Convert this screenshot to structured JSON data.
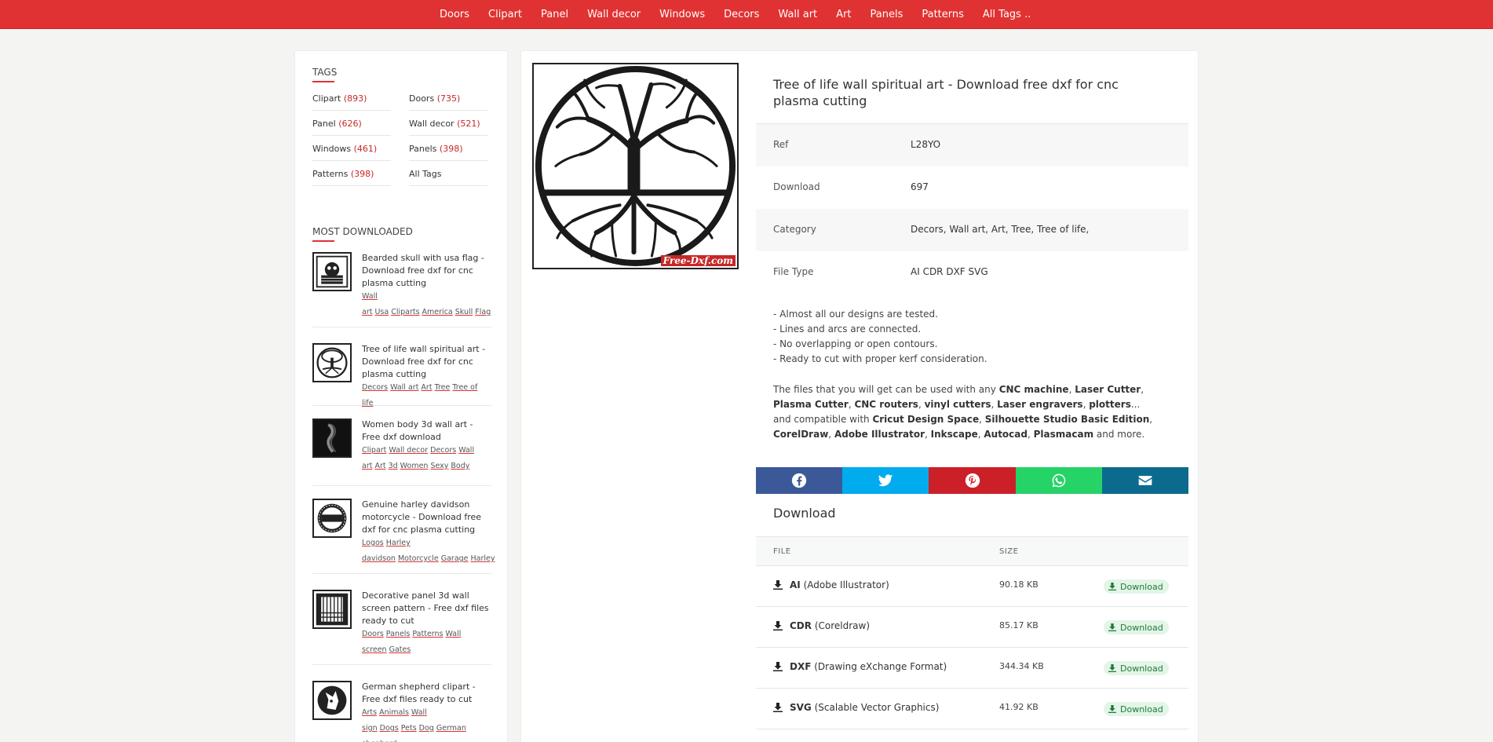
{
  "nav": [
    "Doors",
    "Clipart",
    "Panel",
    "Wall decor",
    "Windows",
    "Decors",
    "Wall art",
    "Art",
    "Panels",
    "Patterns",
    "All Tags .."
  ],
  "sidebar": {
    "tags_title": "TAGS",
    "tags": [
      {
        "name": "Clipart",
        "count": "(893)"
      },
      {
        "name": "Doors",
        "count": "(735)"
      },
      {
        "name": "Panel",
        "count": "(626)"
      },
      {
        "name": "Wall decor",
        "count": "(521)"
      },
      {
        "name": "Windows",
        "count": "(461)"
      },
      {
        "name": "Panels",
        "count": "(398)"
      },
      {
        "name": "Patterns",
        "count": "(398)"
      },
      {
        "name": "All Tags",
        "count": ""
      }
    ],
    "most_downloaded_title": "MOST DOWNLOADED",
    "most_downloaded": [
      {
        "title": "Bearded skull with usa flag - Download free dxf for cnc plasma cutting",
        "tags": [
          "Wall art",
          "Usa",
          "Cliparts",
          "America",
          "Skull",
          "Flag"
        ]
      },
      {
        "title": "Tree of life wall spiritual art - Download free dxf for cnc plasma cutting",
        "tags": [
          "Decors",
          "Wall art",
          "Art",
          "Tree",
          "Tree of life"
        ]
      },
      {
        "title": "Women body 3d wall art - Free dxf download",
        "tags": [
          "Clipart",
          "Wall decor",
          "Decors",
          "Wall art",
          "Art",
          "3d",
          "Women",
          "Sexy",
          "Body"
        ]
      },
      {
        "title": "Genuine harley davidson motorcycle - Download free dxf for cnc plasma cutting",
        "tags": [
          "Logos",
          "Harley davidson",
          "Motorcycle",
          "Garage",
          "Harley"
        ]
      },
      {
        "title": "Decorative panel 3d wall screen pattern - Free dxf files ready to cut",
        "tags": [
          "Doors",
          "Panels",
          "Patterns",
          "Wall screen",
          "Gates"
        ]
      },
      {
        "title": "German shepherd clipart - Free dxf files ready to cut",
        "tags": [
          "Arts",
          "Animals",
          "Wall sign",
          "Dogs",
          "Pets",
          "Dog",
          "German shepherd"
        ]
      }
    ]
  },
  "product": {
    "title": "Tree of life wall spiritual art - Download free dxf for cnc plasma cutting",
    "watermark": "Free-Dxf.com",
    "ref_label": "Ref",
    "ref": "L28YO",
    "download_label": "Download",
    "downloads": "697",
    "category_label": "Category",
    "category": "Decors, Wall art, Art, Tree, Tree of life,",
    "filetype_label": "File Type",
    "filetype": "AI CDR DXF SVG",
    "bullets": [
      "- Almost all our designs are tested.",
      "- Lines and arcs are connected.",
      "- No overlapping or open contours.",
      "- Ready to cut with proper kerf consideration."
    ],
    "compat": {
      "t1": "The files that you will get can be used with any ",
      "b1": "CNC machine",
      "t2": ", ",
      "b2": "Laser Cutter",
      "t3": ", ",
      "b3": "Plasma Cutter",
      "t4": ", ",
      "b4": "CNC routers",
      "t5": ", ",
      "b5": "vinyl cutters",
      "t6": ", ",
      "b6": "Laser engravers",
      "t7": ", ",
      "b7": "plotters",
      "t8": "...",
      "t9": "and compatible with ",
      "b9": "Cricut Design Space",
      "t10": ", ",
      "b10": "Silhouette Studio Basic Edition",
      "t11": ", ",
      "b11": "CorelDraw",
      "t12": ", ",
      "b12": "Adobe Illustrator",
      "t13": ", ",
      "b13": "Inkscape",
      "t14": ", ",
      "b14": "Autocad",
      "t15": ", ",
      "b15": "Plasmacam",
      "t16": " and more."
    }
  },
  "share": [
    {
      "icon": "facebook-icon",
      "color": "#3b5998"
    },
    {
      "icon": "twitter-icon",
      "color": "#00aced"
    },
    {
      "icon": "pinterest-icon",
      "color": "#cb2027"
    },
    {
      "icon": "whatsapp-icon",
      "color": "#25d366"
    },
    {
      "icon": "email-icon",
      "color": "#0b6b8f"
    }
  ],
  "downloads_section": {
    "title": "Download",
    "col_file": "FILE",
    "col_size": "SIZE",
    "button_label": "Download",
    "files": [
      {
        "ext": "AI",
        "desc": "(Adobe Illustrator)",
        "size": "90.18 KB"
      },
      {
        "ext": "CDR",
        "desc": "(Coreldraw)",
        "size": "85.17 KB"
      },
      {
        "ext": "DXF",
        "desc": "(Drawing eXchange Format)",
        "size": "344.34 KB"
      },
      {
        "ext": "SVG",
        "desc": "(Scalable Vector Graphics)",
        "size": "41.92 KB"
      }
    ]
  }
}
